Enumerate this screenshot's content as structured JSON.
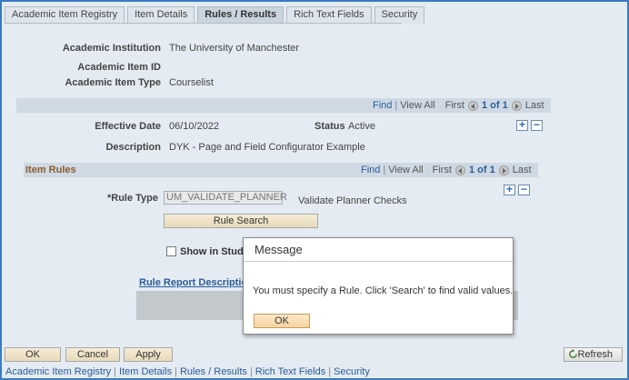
{
  "tabs": [
    "Academic Item Registry",
    "Item Details",
    "Rules / Results",
    "Rich Text Fields",
    "Security"
  ],
  "header": {
    "institution_label": "Academic Institution",
    "institution_value": "The University of Manchester",
    "item_id_label": "Academic Item ID",
    "item_type_label": "Academic Item Type",
    "item_type_value": "Courselist"
  },
  "nav1": {
    "find": "Find",
    "view_all": "View All",
    "first": "First",
    "page": "1 of 1",
    "last": "Last"
  },
  "effective": {
    "date_label": "Effective Date",
    "date_value": "06/10/2022",
    "status_label": "Status",
    "status_value": "Active",
    "desc_label": "Description",
    "desc_value": "DYK - Page and Field Configurator Example"
  },
  "item_rules": {
    "title": "Item Rules",
    "nav": {
      "find": "Find",
      "view_all": "View All",
      "first": "First",
      "page": "1 of 1",
      "last": "Last"
    },
    "rule_type_label": "*Rule Type",
    "rule_type_value": "UM_VALIDATE_PLANNER",
    "rule_type_desc": "Validate Planner Checks",
    "rule_search_label": "Rule Search",
    "show_in_label": "Show in Stude",
    "report_link": "Rule Report Description"
  },
  "modal": {
    "title": "Message",
    "message": "You must specify a Rule.  Click 'Search' to find valid values.",
    "ok": "OK"
  },
  "footer": {
    "ok": "OK",
    "cancel": "Cancel",
    "apply": "Apply",
    "refresh": "Refresh",
    "links": [
      "Academic Item Registry",
      "Item Details",
      "Rules / Results",
      "Rich Text Fields",
      "Security"
    ]
  },
  "icons": {
    "plus": "+",
    "minus": "−"
  }
}
